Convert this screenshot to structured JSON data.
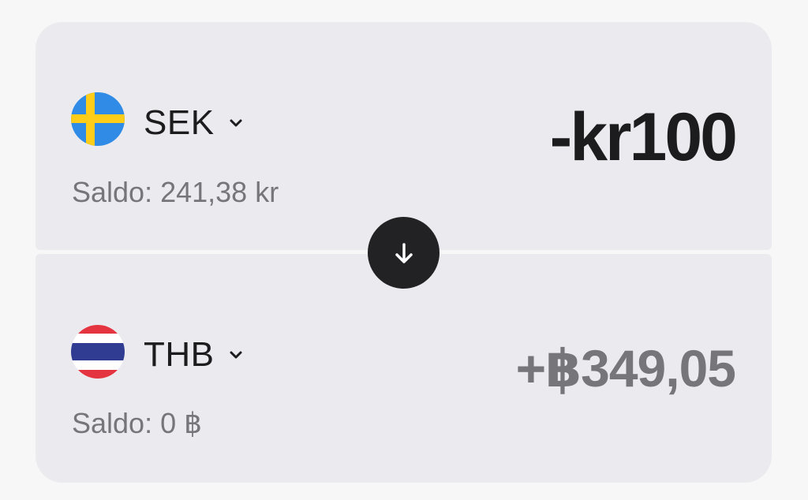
{
  "from": {
    "currency_code": "SEK",
    "flag_icon": "sweden-flag-icon",
    "balance_text": "Saldo: 241,38 kr",
    "amount_text": "-kr100"
  },
  "to": {
    "currency_code": "THB",
    "flag_icon": "thailand-flag-icon",
    "balance_text": "Saldo: 0 ฿",
    "amount_text": "+฿349,05"
  },
  "swap": {
    "icon": "arrow-down-icon"
  },
  "colors": {
    "panel_background": "#ebebef",
    "page_background": "#f7f7f7",
    "primary_text": "#1c1c1e",
    "secondary_text": "#76767a",
    "swap_button": "#222224"
  }
}
